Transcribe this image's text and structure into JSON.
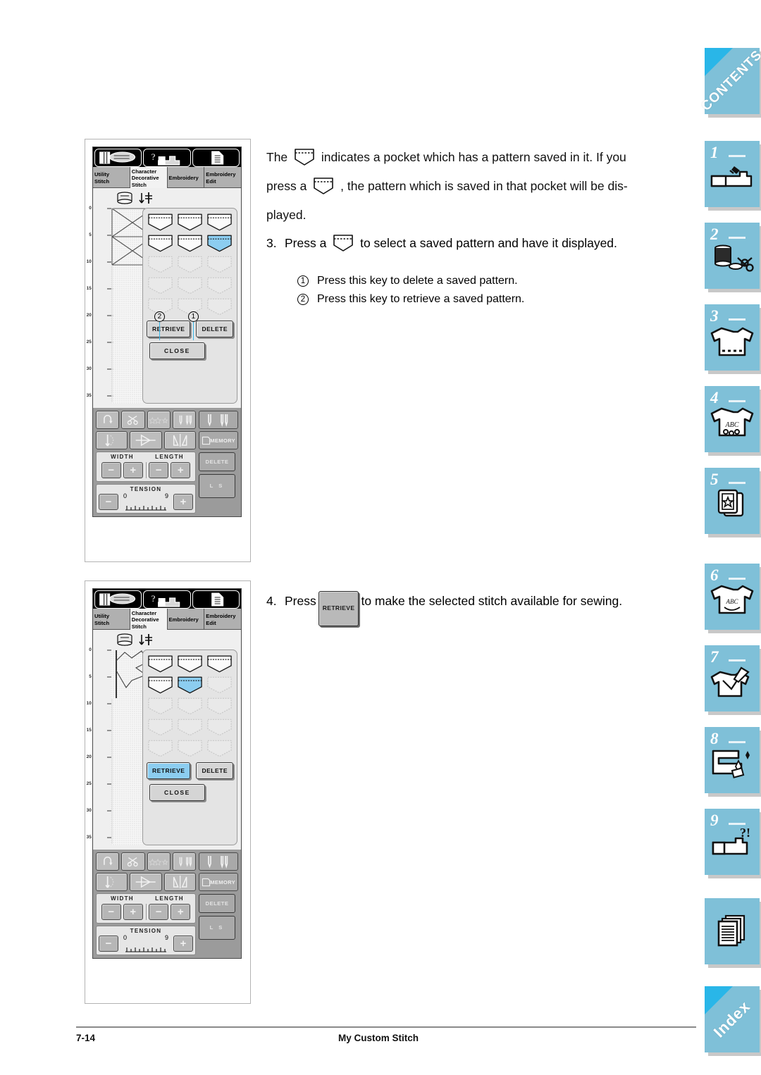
{
  "document": {
    "page_number": "7-14",
    "footer_title": "My Custom Stitch"
  },
  "sidebar": {
    "tabs": [
      {
        "name": "contents",
        "label": "CONTENTS",
        "type": "word",
        "icon": "contents-corner"
      },
      {
        "name": "chapter-1",
        "label": "1",
        "type": "number",
        "icon": "sewing-machine-icon"
      },
      {
        "name": "chapter-2",
        "label": "2",
        "type": "number",
        "icon": "thread-spool-scissors-icon"
      },
      {
        "name": "chapter-3",
        "label": "3",
        "type": "number",
        "icon": "tshirt-stitch-icon"
      },
      {
        "name": "chapter-4",
        "label": "4",
        "type": "number",
        "icon": "tshirt-abc-icon"
      },
      {
        "name": "chapter-5",
        "label": "5",
        "type": "number",
        "icon": "embroidery-card-star-icon"
      },
      {
        "name": "chapter-6",
        "label": "6",
        "type": "number",
        "icon": "tshirt-abc-edit-icon"
      },
      {
        "name": "chapter-7",
        "label": "7",
        "type": "number",
        "icon": "tshirt-pen-icon"
      },
      {
        "name": "chapter-8",
        "label": "8",
        "type": "number",
        "icon": "machine-sparkle-icon"
      },
      {
        "name": "chapter-9",
        "label": "9",
        "type": "number",
        "icon": "machine-question-icon"
      },
      {
        "name": "appendix",
        "label": "",
        "type": "icon",
        "icon": "stacked-pages-icon"
      },
      {
        "name": "index",
        "label": "Index",
        "type": "word",
        "icon": "index-corner"
      }
    ]
  },
  "body": {
    "intro": {
      "part1": "The",
      "part2": "indicates a pocket which has a pattern saved in it. If you",
      "part3": "press a",
      "part4": ", the pattern which is saved in that pocket will be dis-",
      "part5": "played."
    },
    "step3": {
      "number": "3.",
      "part1": "Press a",
      "part2": "to select a saved pattern and have it displayed."
    },
    "substeps": [
      {
        "marker": "1",
        "text": "Press this key to delete a saved pattern."
      },
      {
        "marker": "2",
        "text": "Press this key to retrieve a saved pattern."
      }
    ],
    "step4": {
      "number": "4.",
      "part1": "Press",
      "key_label": "RETRIEVE",
      "part2": "to make the selected stitch available for sewing."
    }
  },
  "screen_common": {
    "icon_buttons": [
      {
        "name": "stitch-chart-icon",
        "label": ""
      },
      {
        "name": "help-machine-icon",
        "label": ""
      },
      {
        "name": "settings-list-icon",
        "label": ""
      }
    ],
    "tabs": [
      {
        "name": "utility-stitch",
        "lines": [
          "Utility",
          "Stitch"
        ],
        "active": false
      },
      {
        "name": "character-decorative-stitch",
        "lines": [
          "Character",
          "Decorative",
          "Stitch"
        ],
        "active": true
      },
      {
        "name": "embroidery",
        "lines": [
          "Embroidery"
        ],
        "active": false
      },
      {
        "name": "embroidery-edit",
        "lines": [
          "Embroidery",
          "Edit"
        ],
        "active": false
      }
    ],
    "ruler_labels": [
      "0",
      "5",
      "10",
      "15",
      "20",
      "25",
      "30",
      "35"
    ],
    "keys": {
      "retrieve": "RETRIEVE",
      "delete": "DELETE",
      "close": "CLOSE"
    },
    "controls": {
      "memory_label": "MEMORY",
      "delete_label": "DELETE",
      "ls_label": "L   S",
      "width_label": "WIDTH",
      "length_label": "LENGTH",
      "tension_label": "TENSION",
      "tension_min": "0",
      "tension_max": "9",
      "minus": "−",
      "plus": "+",
      "row1_icons": [
        "reverse-stitch-icon",
        "thread-cutter-icon",
        "decorative-stars-icon",
        "needle-position-icon"
      ],
      "row2_icons": [
        "needle-threader-icon",
        "presser-foot-icon",
        "mirror-image-icon",
        "memory-icon"
      ]
    },
    "selected_color": "#8ccdf0",
    "callout_line_color": "#35b6e8"
  },
  "screen1": {
    "name": "pocket-selection-screen",
    "pockets": [
      {
        "state": "filled"
      },
      {
        "state": "filled"
      },
      {
        "state": "filled"
      },
      {
        "state": "filled"
      },
      {
        "state": "filled"
      },
      {
        "state": "selected"
      },
      {
        "state": "empty"
      },
      {
        "state": "empty"
      },
      {
        "state": "empty"
      },
      {
        "state": "empty"
      },
      {
        "state": "empty"
      },
      {
        "state": "empty"
      },
      {
        "state": "empty"
      },
      {
        "state": "empty"
      },
      {
        "state": "empty"
      }
    ],
    "retrieve_highlighted": false,
    "callouts": [
      {
        "marker": "2",
        "target": "retrieve-key"
      },
      {
        "marker": "1",
        "target": "delete-key"
      }
    ],
    "stitch_preview": "crossed-box-pattern"
  },
  "screen2": {
    "name": "pattern-retrieved-screen",
    "pockets": [
      {
        "state": "filled"
      },
      {
        "state": "filled"
      },
      {
        "state": "filled"
      },
      {
        "state": "filled"
      },
      {
        "state": "selected"
      },
      {
        "state": "empty"
      },
      {
        "state": "empty"
      },
      {
        "state": "empty"
      },
      {
        "state": "empty"
      },
      {
        "state": "empty"
      },
      {
        "state": "empty"
      },
      {
        "state": "empty"
      },
      {
        "state": "empty"
      },
      {
        "state": "empty"
      },
      {
        "state": "empty"
      }
    ],
    "retrieve_highlighted": true,
    "callouts": [],
    "stitch_preview": "zigzag-arrow-pattern"
  }
}
